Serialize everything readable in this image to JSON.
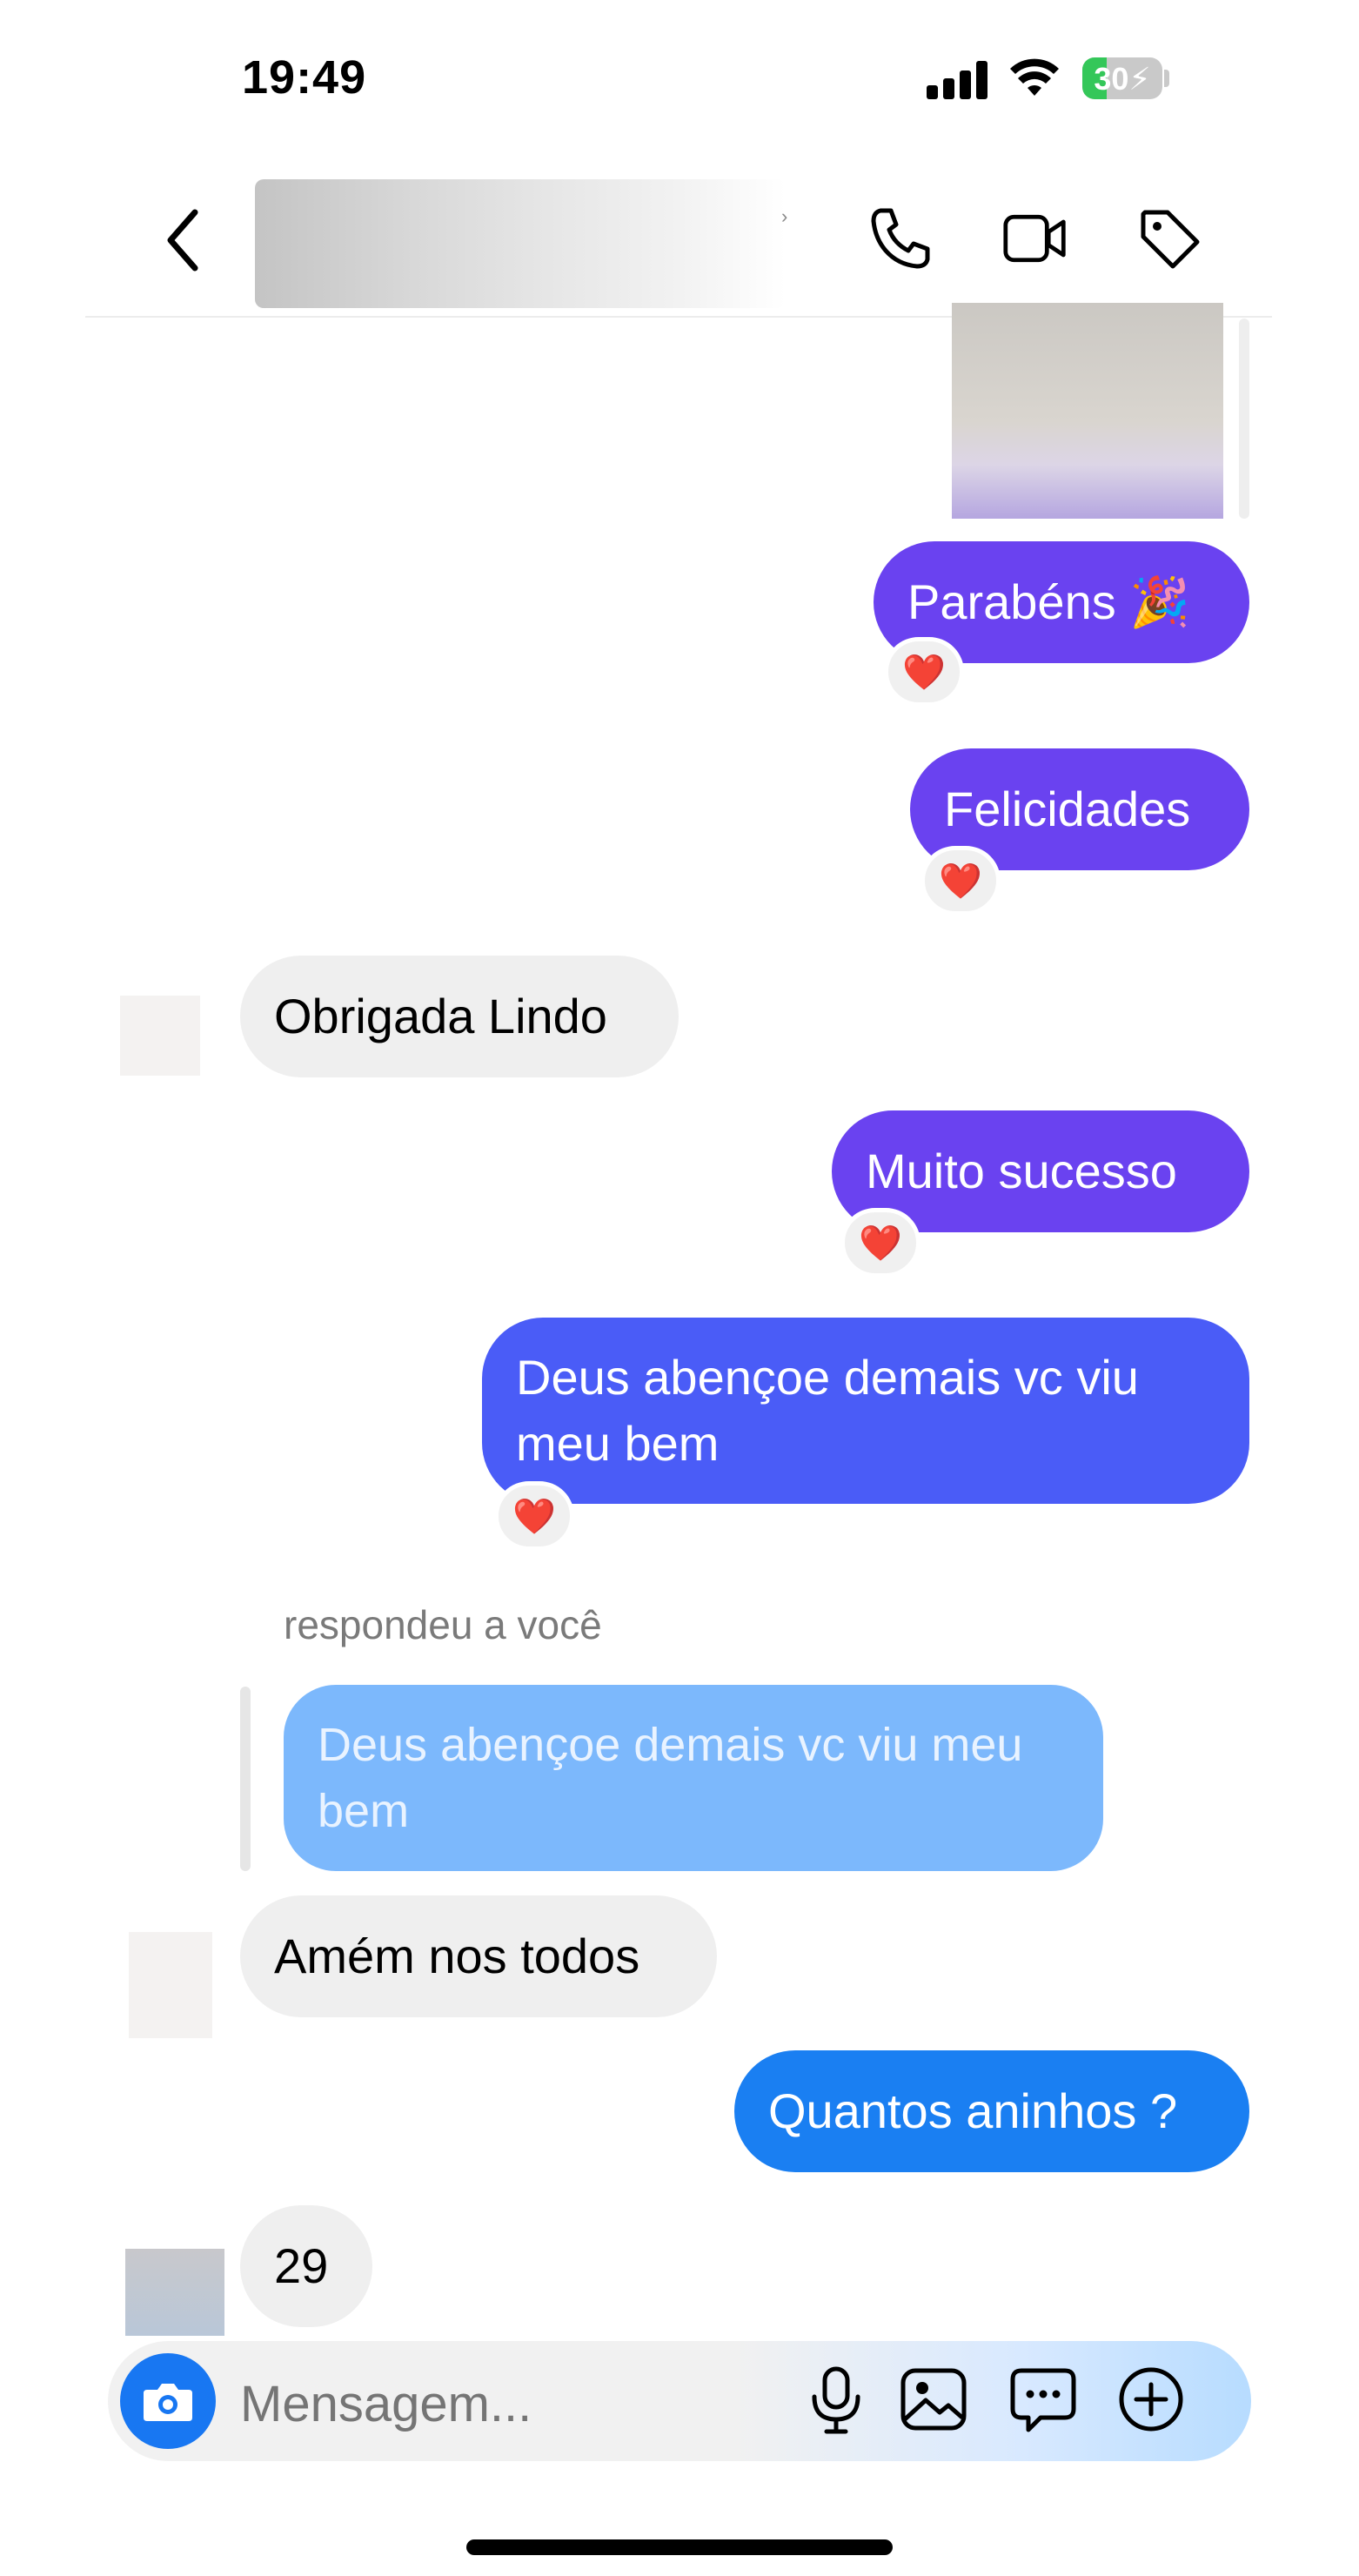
{
  "status_bar": {
    "time": "19:49",
    "battery_level": "30",
    "battery_charging": true
  },
  "header": {
    "chevron": "›"
  },
  "messages": [
    {
      "side": "out",
      "text": "Parabéns 🎉",
      "reaction": "❤️"
    },
    {
      "side": "out",
      "text": "Felicidades",
      "reaction": "❤️"
    },
    {
      "side": "in",
      "text": "Obrigada Lindo"
    },
    {
      "side": "out",
      "text": "Muito sucesso",
      "reaction": "❤️"
    },
    {
      "side": "out",
      "text_line1": "Deus abençoe demais vc viu",
      "text_line2": "meu bem",
      "reaction": "❤️"
    },
    {
      "side": "in",
      "reply_label": "respondeu a você",
      "quoted_line1": "Deus abençoe demais vc viu meu",
      "quoted_line2": "bem",
      "text": "Amém nos todos"
    },
    {
      "side": "out",
      "text": "Quantos aninhos ?"
    },
    {
      "side": "in",
      "text": "29"
    }
  ],
  "composer": {
    "placeholder": "Mensagem..."
  },
  "colors": {
    "bubble_purple": "#6a42f0",
    "bubble_indigo": "#4a5cf7",
    "bubble_blue": "#1a7ff2",
    "quote_blue": "#7cb8fc",
    "camera_blue": "#1877f2"
  }
}
